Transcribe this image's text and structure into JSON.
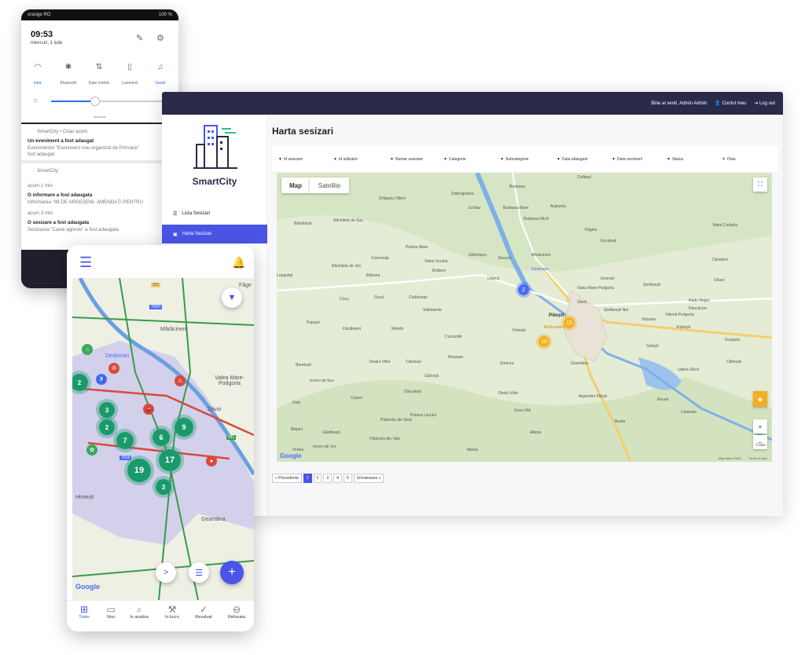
{
  "notif_panel": {
    "status_left": "orange RO",
    "status_right": "100 %",
    "time": "09:53",
    "date": "miercuri, 1 iulie",
    "quick_settings": [
      {
        "icon": "wifi-icon",
        "label": "mmc"
      },
      {
        "icon": "bluetooth-icon",
        "label": "Bluetooth"
      },
      {
        "icon": "mobile-data-icon",
        "label": "Date mobile"
      },
      {
        "icon": "flashlight-icon",
        "label": "Lanternă"
      },
      {
        "icon": "bell-icon",
        "label": "Sunet"
      }
    ],
    "notifications": [
      {
        "app": "SmartCity • Chiar acum",
        "title": "Un eveniment a fost adaugat",
        "body1": "Evenimentul \"Eveniment nou organizat de Primarie\"",
        "body2": "fost adaugat"
      },
      {
        "app": "SmartCity"
      },
      {
        "time": "acum 1 min",
        "title": "O informare a fost adaugata",
        "body1": "Informarea \"48 DE ARGEȘENI- AMENDAȚI PENTRU"
      },
      {
        "time": "acum 3 min",
        "title": "O sesizare a fost adaugata",
        "body1": "Sesizarea \"Caine agresiv\" a fost adaugata"
      }
    ]
  },
  "desktop": {
    "topbar": {
      "welcome": "Bine ai venit, Admin Admin",
      "account": "Contul meu",
      "logout": "Log out"
    },
    "brand": "SmartCity",
    "nav": {
      "lista": "Lista Sesizari",
      "harta": "Harta Sesizari"
    },
    "page_title": "Harta sesizari",
    "filters": [
      "Id sesizare",
      "Id utilizator",
      "Numar sesizare",
      "Categorie",
      "Subcategorie",
      "Data adaugarii",
      "Data rezolvarii",
      "Status",
      "Oras"
    ],
    "map": {
      "tab_map": "Map",
      "tab_satellite": "Satellite",
      "footer_data": "Map data ©2021",
      "footer_terms": "Terms of Use",
      "logo": "Google",
      "clusters": [
        {
          "label": "2",
          "color": "#4a6cf7"
        },
        {
          "label": "13",
          "color": "#f2b01e"
        },
        {
          "label": "10",
          "color": "#f2b01e"
        }
      ],
      "places": [
        "Colibași",
        "Budeasa",
        "Dobrogostea",
        "Drăganu-Olteni",
        "Schiau",
        "Budeasa Mare",
        "Argeșelu",
        "Budeasa Mică",
        "Făgetu",
        "Valea Corbului",
        "Bărbătești",
        "Răchitele de Sus",
        "Enculești",
        "Pristou Mare",
        "Cotmenița",
        "Valea Ursului",
        "Glâmbocu",
        "Bascov",
        "Mărăcineni",
        "Cârstieni",
        "Lunguleți",
        "Răchitele de Jos",
        "Băbana",
        "Brăileni",
        "Dedeman",
        "Uiasca",
        "Izvorani",
        "Ștefănești",
        "Valea Mare-Podgoria",
        "Uliuce",
        "Cocu",
        "Groși",
        "Ciobănești",
        "Zăvoi",
        "Radu Negru",
        "Rancăciov",
        "Slătioarele",
        "Ștefănești Noi",
        "Viișoara",
        "Vâlenii-Podgoria",
        "Popești",
        "Pitești",
        "McDonald's",
        "Vrănești",
        "Făcăleteni",
        "Metofu",
        "Crucanăk",
        "Hintești",
        "Golești",
        "Gorganu",
        "Moșoaia",
        "Buretești",
        "Dealul Viilor",
        "Câtunași",
        "Smeura",
        "Geamăna",
        "Călinești",
        "Udeni-Zăvoi",
        "Izvoru de Sus",
        "Gălcești",
        "Dinculești",
        "Deslu Viilor",
        "Arpechim Pitești",
        "Recea",
        "Fata",
        "Cepari",
        "Poiana Lacului",
        "Gura Văii",
        "Catanele",
        "Bradu",
        "Blejani",
        "Gărdinești",
        "Păduroiu din Deal",
        "Albota",
        "Vedea",
        "Izvoru de Jos",
        "Păduroiu din Vale",
        "Mareș",
        "Coșe"
      ]
    },
    "pagination": {
      "prev": "« Precedenta",
      "pages": [
        "1",
        "2",
        "3",
        "4",
        "5"
      ],
      "next": "Urmatoarea »",
      "active": "1"
    }
  },
  "mobile": {
    "map_places": [
      "Făge",
      "Mărăcineni",
      "Dedeman",
      "Valea Mare-Podgoria",
      "Zăvoi",
      "Hintești",
      "Geamăna",
      "Google",
      "221",
      "703H",
      "681",
      "7018"
    ],
    "clusters": [
      "2",
      "3",
      "2",
      "7",
      "6",
      "9",
      "17",
      "19",
      "3"
    ],
    "nav": [
      {
        "icon": "grid-icon",
        "label": "Toate"
      },
      {
        "icon": "new-icon",
        "label": "Nou"
      },
      {
        "icon": "search-doc-icon",
        "label": "In analiza"
      },
      {
        "icon": "tools-icon",
        "label": "In lucru"
      },
      {
        "icon": "check-icon",
        "label": "Rezolvat"
      },
      {
        "icon": "refuse-icon",
        "label": "Refuzata"
      }
    ]
  }
}
